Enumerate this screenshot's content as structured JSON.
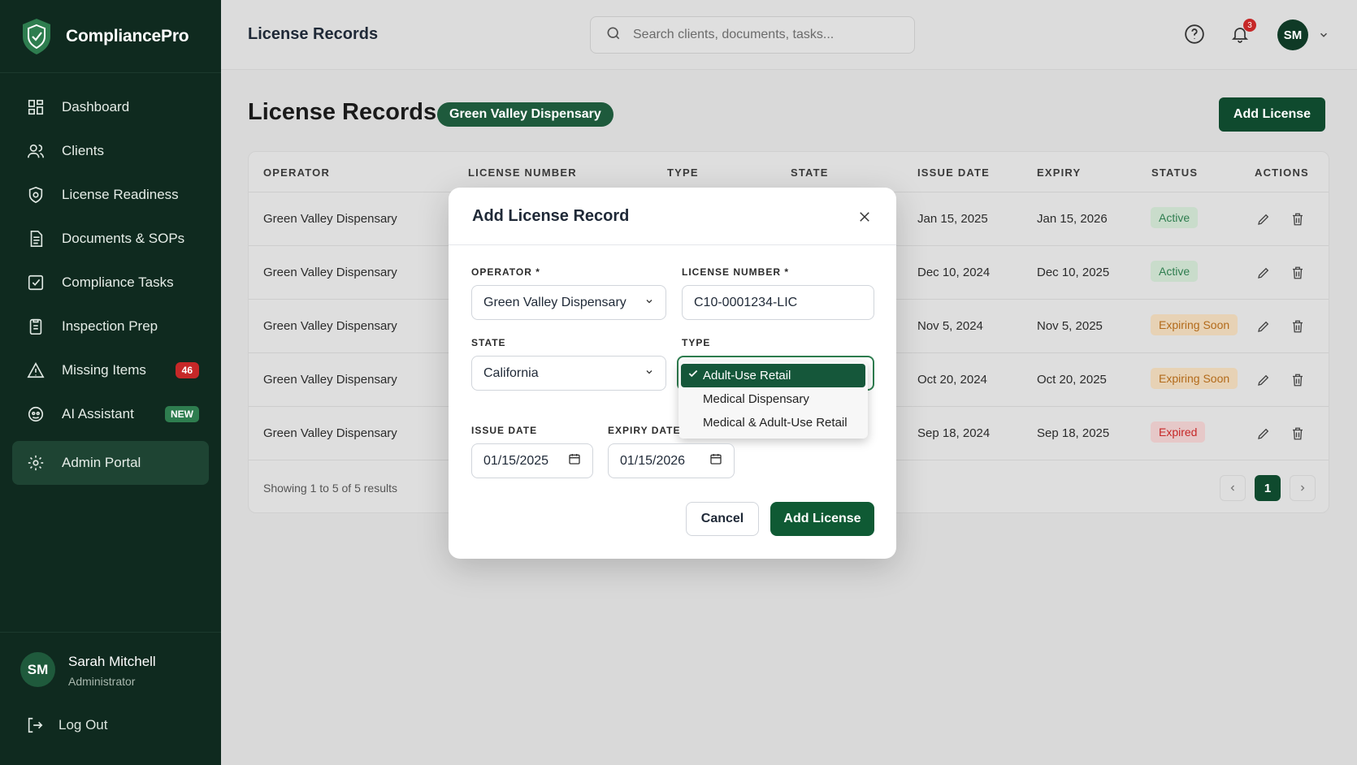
{
  "brand": {
    "name": "CompliancePro"
  },
  "sidebar": {
    "items": [
      {
        "label": "Dashboard",
        "icon": "dashboard-icon"
      },
      {
        "label": "Clients",
        "icon": "users-icon"
      },
      {
        "label": "License Readiness",
        "icon": "shield-check-icon"
      },
      {
        "label": "Documents & SOPs",
        "icon": "document-icon"
      },
      {
        "label": "Compliance Tasks",
        "icon": "checkbox-icon"
      },
      {
        "label": "Inspection Prep",
        "icon": "clipboard-icon"
      },
      {
        "label": "Missing Items",
        "icon": "warning-icon",
        "badge": "46"
      },
      {
        "label": "AI Assistant",
        "icon": "ai-icon",
        "badge": "NEW"
      },
      {
        "label": "Admin Portal",
        "icon": "gear-icon",
        "active": true
      }
    ],
    "user": {
      "initials": "SM",
      "name": "Sarah Mitchell",
      "role": "Administrator"
    },
    "logout": "Log Out"
  },
  "header": {
    "title": "License Records",
    "search_placeholder": "Search clients, documents, tasks...",
    "notifications": "3",
    "avatar": "SM"
  },
  "page": {
    "title": "License Records",
    "operator_pill": "Green Valley Dispensary",
    "add_button": "Add License"
  },
  "table": {
    "columns": [
      "OPERATOR",
      "LICENSE NUMBER",
      "TYPE",
      "STATE",
      "ISSUE DATE",
      "EXPIRY",
      "STATUS",
      "ACTIONS"
    ],
    "rows": [
      {
        "operator": "Green Valley Dispensary",
        "issue": "Jan 15, 2025",
        "expiry": "Jan 15, 2026",
        "status": "Active",
        "status_kind": "active"
      },
      {
        "operator": "Green Valley Dispensary",
        "issue": "Dec 10, 2024",
        "expiry": "Dec 10, 2025",
        "status": "Active",
        "status_kind": "active"
      },
      {
        "operator": "Green Valley Dispensary",
        "issue": "Nov 5, 2024",
        "expiry": "Nov 5, 2025",
        "status": "Expiring Soon",
        "status_kind": "soon"
      },
      {
        "operator": "Green Valley Dispensary",
        "issue": "Oct 20, 2024",
        "expiry": "Oct 20, 2025",
        "status": "Expiring Soon",
        "status_kind": "soon"
      },
      {
        "operator": "Green Valley Dispensary",
        "issue": "Sep 18, 2024",
        "expiry": "Sep 18, 2025",
        "status": "Expired",
        "status_kind": "expired"
      }
    ],
    "footer": "Showing 1 to 5 of 5 results",
    "page": "1"
  },
  "modal": {
    "title": "Add License Record",
    "operator_label": "OPERATOR *",
    "operator_value": "Green Valley Dispensary",
    "license_label": "LICENSE NUMBER *",
    "license_value": "C10-0001234-LIC",
    "state_label": "STATE",
    "state_value": "California",
    "type_label": "TYPE",
    "type_options": [
      "Adult-Use Retail",
      "Medical Dispensary",
      "Medical & Adult-Use Retail"
    ],
    "issue_label": "ISSUE DATE",
    "issue_value": "01/15/2025",
    "expiry_label": "EXPIRY DATE",
    "expiry_value": "01/15/2026",
    "cancel": "Cancel",
    "submit": "Add License"
  },
  "colors": {
    "sidebar_bg": "#0f2a1f",
    "primary": "#0f5a34",
    "active": "#2e7d4f",
    "warning": "#b26a1a",
    "danger": "#c62828"
  }
}
